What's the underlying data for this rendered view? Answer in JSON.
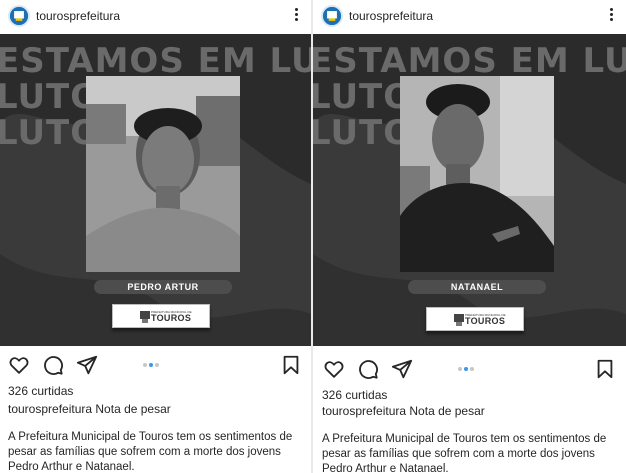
{
  "posts": [
    {
      "username": "tourosprefeitura",
      "background_text": [
        "ESTAMOS EM LUTO",
        "LUTO",
        "LUTO"
      ],
      "name_label": "PEDRO ARTUR",
      "logo_small_text": "PREFEITURA MUNICIPAL DE",
      "logo_text": "TOUROS",
      "likes": "326 curtidas",
      "caption_user": "tourosprefeitura",
      "caption_text": "Nota de pesar",
      "description": "A Prefeitura Municipal de Touros tem os sentimentos de pesar as famílias que sofrem com a morte dos jovens Pedro Arthur e Natanael."
    },
    {
      "username": "tourosprefeitura",
      "background_text": [
        "ESTAMOS EM LUTO",
        "LUTO",
        "LUTO"
      ],
      "name_label": "NATANAEL",
      "logo_small_text": "PREFEITURA MUNICIPAL DE",
      "logo_text": "TOUROS",
      "likes": "326 curtidas",
      "caption_user": "tourosprefeitura",
      "caption_text": "Nota de pesar",
      "description": "A Prefeitura Municipal de Touros tem os sentimentos de pesar as famílias que sofrem com a morte dos jovens Pedro Arthur e Natanael."
    }
  ],
  "icons": {
    "like": "heart-icon",
    "comment": "comment-icon",
    "share": "share-icon",
    "save": "bookmark-icon",
    "more": "more-options-icon"
  },
  "carousel": {
    "count": 3,
    "active": 2
  },
  "colors": {
    "media_bg": "#3a3a3a",
    "nameplate": "#4d4d4d",
    "carousel_active": "#3897f0",
    "avatar": "#1f6fb5"
  }
}
